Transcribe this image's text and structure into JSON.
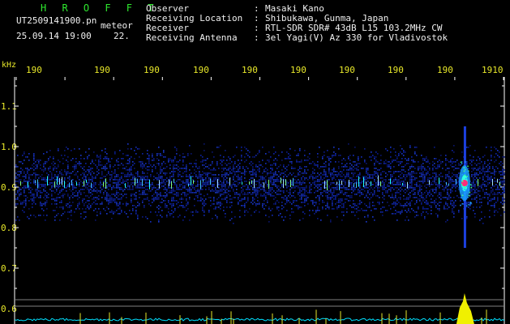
{
  "header": {
    "app_title": "H R O F F T",
    "file_name": "UT2509141900.pn",
    "mode_label": "meteor",
    "date_time": "25.09.14 19:00",
    "count_value": "22.",
    "info": [
      {
        "label": "Observer",
        "value": "Masaki Kano"
      },
      {
        "label": "Receiving Location",
        "value": "Shibukawa, Gunma, Japan"
      },
      {
        "label": "Receiver",
        "value": "RTL-SDR SDR# 43dB L15 103.2MHz CW"
      },
      {
        "label": "Receiving Antenna",
        "value": "3el Yagi(V) Az 330 for Vladivostok"
      }
    ]
  },
  "colors": {
    "title": "#2ee82e",
    "text": "#f0f0f0",
    "axis_labels": "#e8e82a",
    "background": "#000000",
    "spectrum": "#00e0ff",
    "echo": "#ff2a7a"
  },
  "chart_data": {
    "type": "heatmap",
    "y_unit_label": "kHz",
    "x_tick_labels": [
      "190",
      "190",
      "190",
      "190",
      "190",
      "190",
      "190",
      "190",
      "190",
      "1910"
    ],
    "y_ticks": [
      {
        "value": 1.1,
        "label": "1.1"
      },
      {
        "value": 1.0,
        "label": "1.0"
      },
      {
        "value": 0.9,
        "label": "0.9"
      },
      {
        "value": 0.8,
        "label": "0.8"
      },
      {
        "value": 0.7,
        "label": "0.7"
      },
      {
        "value": 0.6,
        "label": "0.6"
      }
    ],
    "ylim": [
      0.6,
      1.2
    ],
    "xlim": [
      1900,
      1910
    ],
    "noise_band_khz": [
      0.8,
      1.0
    ],
    "carrier_khz": 0.91,
    "meteor_echo": {
      "time": 1909.2,
      "freq_khz": 0.91
    }
  }
}
